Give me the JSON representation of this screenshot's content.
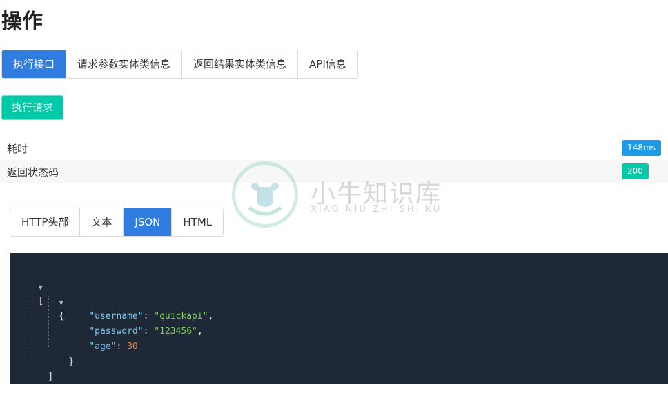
{
  "page": {
    "title": "操作"
  },
  "tabs": [
    {
      "label": "执行接口",
      "active": true
    },
    {
      "label": "请求参数实体类信息",
      "active": false
    },
    {
      "label": "返回结果实体类信息",
      "active": false
    },
    {
      "label": "API信息",
      "active": false
    }
  ],
  "execute_button": {
    "label": "执行请求"
  },
  "info": {
    "elapsed": {
      "label": "耗时",
      "value": "148ms"
    },
    "status": {
      "label": "返回状态码",
      "value": "200"
    }
  },
  "watermark": {
    "title": "小牛知识库",
    "subtitle": "XIAO NIU ZHI SHI KU"
  },
  "format_tabs": [
    {
      "label": "HTTP头部",
      "active": false
    },
    {
      "label": "文本",
      "active": false
    },
    {
      "label": "JSON",
      "active": true
    },
    {
      "label": "HTML",
      "active": false
    }
  ],
  "json_view": {
    "open_array": "[",
    "open_object": "{",
    "fields": [
      {
        "key": "\"username\"",
        "value": "\"quickapi\"",
        "type": "string",
        "comma": ","
      },
      {
        "key": "\"password\"",
        "value": "\"123456\"",
        "type": "string",
        "comma": ","
      },
      {
        "key": "\"age\"",
        "value": "30",
        "type": "number",
        "comma": ""
      }
    ],
    "close_object": "}",
    "close_array": "]",
    "colon": ": "
  },
  "colors": {
    "primary": "#2f7de1",
    "success": "#00c9a7",
    "badge_blue": "#1e9be8",
    "code_bg": "#1e2836",
    "json_key": "#76c6f0",
    "json_string": "#7ecf5c",
    "json_number": "#f08a3c"
  },
  "icons": {
    "toggle": "triangle-down-icon",
    "watermark_logo": "bull-logo"
  }
}
